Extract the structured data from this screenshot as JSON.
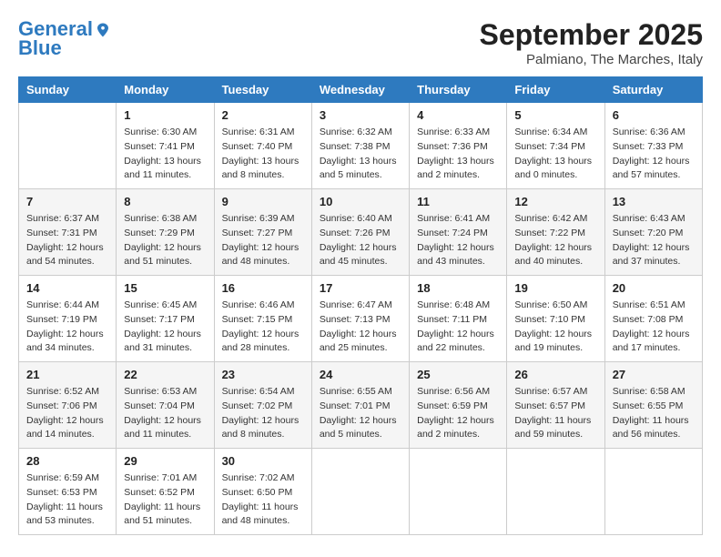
{
  "header": {
    "logo_line1": "General",
    "logo_line2": "Blue",
    "month_title": "September 2025",
    "subtitle": "Palmiano, The Marches, Italy"
  },
  "columns": [
    "Sunday",
    "Monday",
    "Tuesday",
    "Wednesday",
    "Thursday",
    "Friday",
    "Saturday"
  ],
  "weeks": [
    [
      {
        "day": "",
        "info": ""
      },
      {
        "day": "1",
        "info": "Sunrise: 6:30 AM\nSunset: 7:41 PM\nDaylight: 13 hours\nand 11 minutes."
      },
      {
        "day": "2",
        "info": "Sunrise: 6:31 AM\nSunset: 7:40 PM\nDaylight: 13 hours\nand 8 minutes."
      },
      {
        "day": "3",
        "info": "Sunrise: 6:32 AM\nSunset: 7:38 PM\nDaylight: 13 hours\nand 5 minutes."
      },
      {
        "day": "4",
        "info": "Sunrise: 6:33 AM\nSunset: 7:36 PM\nDaylight: 13 hours\nand 2 minutes."
      },
      {
        "day": "5",
        "info": "Sunrise: 6:34 AM\nSunset: 7:34 PM\nDaylight: 13 hours\nand 0 minutes."
      },
      {
        "day": "6",
        "info": "Sunrise: 6:36 AM\nSunset: 7:33 PM\nDaylight: 12 hours\nand 57 minutes."
      }
    ],
    [
      {
        "day": "7",
        "info": "Sunrise: 6:37 AM\nSunset: 7:31 PM\nDaylight: 12 hours\nand 54 minutes."
      },
      {
        "day": "8",
        "info": "Sunrise: 6:38 AM\nSunset: 7:29 PM\nDaylight: 12 hours\nand 51 minutes."
      },
      {
        "day": "9",
        "info": "Sunrise: 6:39 AM\nSunset: 7:27 PM\nDaylight: 12 hours\nand 48 minutes."
      },
      {
        "day": "10",
        "info": "Sunrise: 6:40 AM\nSunset: 7:26 PM\nDaylight: 12 hours\nand 45 minutes."
      },
      {
        "day": "11",
        "info": "Sunrise: 6:41 AM\nSunset: 7:24 PM\nDaylight: 12 hours\nand 43 minutes."
      },
      {
        "day": "12",
        "info": "Sunrise: 6:42 AM\nSunset: 7:22 PM\nDaylight: 12 hours\nand 40 minutes."
      },
      {
        "day": "13",
        "info": "Sunrise: 6:43 AM\nSunset: 7:20 PM\nDaylight: 12 hours\nand 37 minutes."
      }
    ],
    [
      {
        "day": "14",
        "info": "Sunrise: 6:44 AM\nSunset: 7:19 PM\nDaylight: 12 hours\nand 34 minutes."
      },
      {
        "day": "15",
        "info": "Sunrise: 6:45 AM\nSunset: 7:17 PM\nDaylight: 12 hours\nand 31 minutes."
      },
      {
        "day": "16",
        "info": "Sunrise: 6:46 AM\nSunset: 7:15 PM\nDaylight: 12 hours\nand 28 minutes."
      },
      {
        "day": "17",
        "info": "Sunrise: 6:47 AM\nSunset: 7:13 PM\nDaylight: 12 hours\nand 25 minutes."
      },
      {
        "day": "18",
        "info": "Sunrise: 6:48 AM\nSunset: 7:11 PM\nDaylight: 12 hours\nand 22 minutes."
      },
      {
        "day": "19",
        "info": "Sunrise: 6:50 AM\nSunset: 7:10 PM\nDaylight: 12 hours\nand 19 minutes."
      },
      {
        "day": "20",
        "info": "Sunrise: 6:51 AM\nSunset: 7:08 PM\nDaylight: 12 hours\nand 17 minutes."
      }
    ],
    [
      {
        "day": "21",
        "info": "Sunrise: 6:52 AM\nSunset: 7:06 PM\nDaylight: 12 hours\nand 14 minutes."
      },
      {
        "day": "22",
        "info": "Sunrise: 6:53 AM\nSunset: 7:04 PM\nDaylight: 12 hours\nand 11 minutes."
      },
      {
        "day": "23",
        "info": "Sunrise: 6:54 AM\nSunset: 7:02 PM\nDaylight: 12 hours\nand 8 minutes."
      },
      {
        "day": "24",
        "info": "Sunrise: 6:55 AM\nSunset: 7:01 PM\nDaylight: 12 hours\nand 5 minutes."
      },
      {
        "day": "25",
        "info": "Sunrise: 6:56 AM\nSunset: 6:59 PM\nDaylight: 12 hours\nand 2 minutes."
      },
      {
        "day": "26",
        "info": "Sunrise: 6:57 AM\nSunset: 6:57 PM\nDaylight: 11 hours\nand 59 minutes."
      },
      {
        "day": "27",
        "info": "Sunrise: 6:58 AM\nSunset: 6:55 PM\nDaylight: 11 hours\nand 56 minutes."
      }
    ],
    [
      {
        "day": "28",
        "info": "Sunrise: 6:59 AM\nSunset: 6:53 PM\nDaylight: 11 hours\nand 53 minutes."
      },
      {
        "day": "29",
        "info": "Sunrise: 7:01 AM\nSunset: 6:52 PM\nDaylight: 11 hours\nand 51 minutes."
      },
      {
        "day": "30",
        "info": "Sunrise: 7:02 AM\nSunset: 6:50 PM\nDaylight: 11 hours\nand 48 minutes."
      },
      {
        "day": "",
        "info": ""
      },
      {
        "day": "",
        "info": ""
      },
      {
        "day": "",
        "info": ""
      },
      {
        "day": "",
        "info": ""
      }
    ]
  ]
}
